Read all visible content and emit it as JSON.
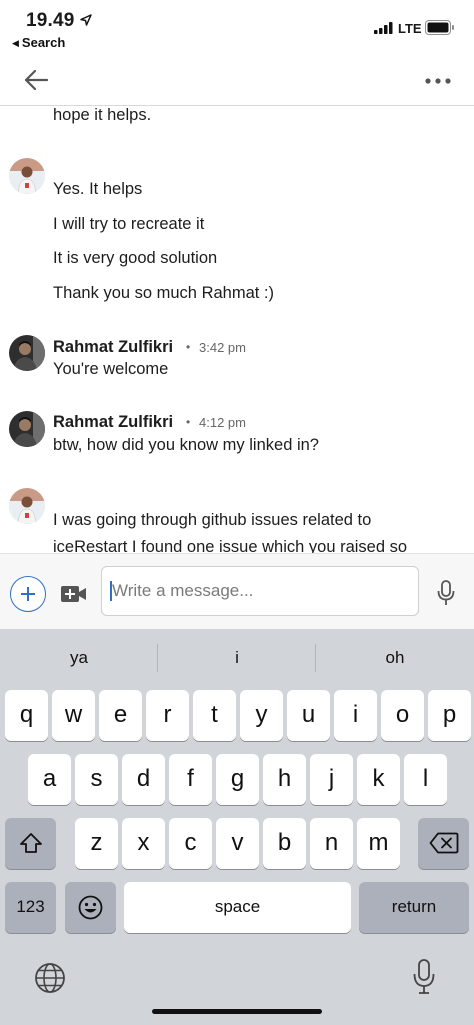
{
  "status_bar": {
    "time": "19.49",
    "back_app": "Search",
    "network": "LTE"
  },
  "nav": {
    "back_icon": "arrow-left-icon",
    "more_icon": "more-dots-icon"
  },
  "messages": {
    "partial_top": "hope it helps.",
    "group1": {
      "lines": [
        "Yes. It helps",
        "I will try to recreate it",
        "It is very good solution",
        "Thank you so much Rahmat :)"
      ]
    },
    "group2": {
      "sender": "Rahmat Zulfikri",
      "time": "3:42 pm",
      "text": "You're welcome"
    },
    "group3": {
      "sender": "Rahmat Zulfikri",
      "time": "4:12 pm",
      "text": "btw, how did you know my linked in?"
    },
    "group4": {
      "lines": [
        "I was going through github issues related to",
        "iceRestart I found one issue which you raised so"
      ]
    }
  },
  "compose": {
    "placeholder": "Write a message...",
    "add_icon": "plus-icon",
    "video_icon": "video-camera-icon",
    "mic_icon": "microphone-icon",
    "accent": "#2f6fc6"
  },
  "keyboard": {
    "suggestions": [
      "ya",
      "i",
      "oh"
    ],
    "row1": [
      "q",
      "w",
      "e",
      "r",
      "t",
      "y",
      "u",
      "i",
      "o",
      "p"
    ],
    "row2": [
      "a",
      "s",
      "d",
      "f",
      "g",
      "h",
      "j",
      "k",
      "l"
    ],
    "row3": [
      "z",
      "x",
      "c",
      "v",
      "b",
      "n",
      "m"
    ],
    "numbers_label": "123",
    "space_label": "space",
    "return_label": "return"
  }
}
